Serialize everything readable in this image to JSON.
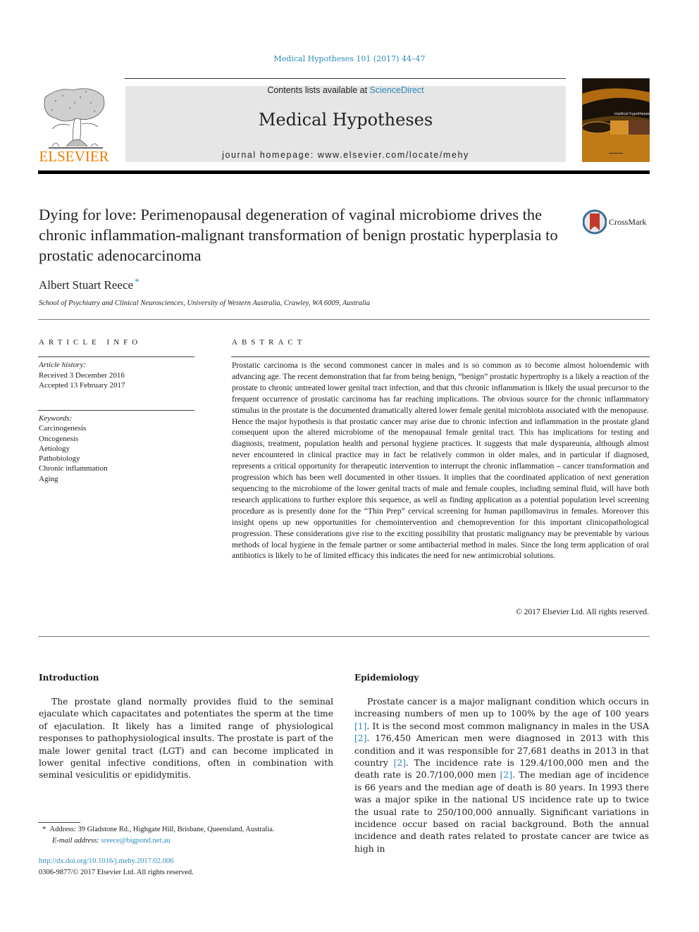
{
  "header": {
    "journal_ref": "Medical Hypotheses 101 (2017) 44–47",
    "contents_prefix": "Contents lists available at ",
    "contents_link": "ScienceDirect",
    "journal_title": "Medical Hypotheses",
    "homepage": "journal homepage: www.elsevier.com/locate/mehy",
    "publisher_wordmark": "ELSEVIER",
    "cover_title": "medical hypotheses",
    "crossmark_label": "CrossMark"
  },
  "article": {
    "title": "Dying for love: Perimenopausal degeneration of vaginal microbiome drives the chronic inflammation-malignant transformation of benign prostatic hyperplasia to prostatic adenocarcinoma",
    "author": "Albert Stuart Reece",
    "author_mark": "*",
    "affiliation": "School of Psychiatry and Clinical Neurosciences, University of Western Australia, Crawley, WA 6009, Australia"
  },
  "article_info": {
    "heading": "ARTICLE INFO",
    "history_label": "Article history:",
    "received": "Received 3 December 2016",
    "accepted": "Accepted 13 February 2017",
    "keywords_label": "Keywords:",
    "keywords": [
      "Carcinogenesis",
      "Oncogenesis",
      "Aetiology",
      "Pathobiology",
      "Chronic inflammation",
      "Aging"
    ]
  },
  "abstract": {
    "heading": "ABSTRACT",
    "text": "Prostatic carcinoma is the second commonest cancer in males and is so common as to become almost holoendemic with advancing age. The recent demonstration that far from being benign, “benign” prostatic hypertrophy is a likely a reaction of the prostate to chronic untreated lower genital tract infection, and that this chronic inflammation is likely the usual precursor to the frequent occurrence of prostatic carcinoma has far reaching implications. The obvious source for the chronic inflammatory stimulus in the prostate is the documented dramatically altered lower female genital microbiota associated with the menopause. Hence the major hypothesis is that prostatic cancer may arise due to chronic infection and inflammation in the prostate gland consequent upon the altered microbiome of the menopausal female genital tract. This has implications for testing and diagnosis, treatment, population health and personal hygiene practices. It suggests that male dyspareunia, although almost never encountered in clinical practice may in fact be relatively common in older males, and in particular if diagnosed, represents a critical opportunity for therapeutic intervention to interrupt the chronic inflammation – cancer transformation and progression which has been well documented in other tissues. It implies that the coordinated application of next generation sequencing to the microbiome of the lower genital tracts of male and female couples, including seminal fluid, will have both research applications to further explore this sequence, as well as finding application as a potential population level screening procedure as is presently done for the “Thin Prep” cervical screening for human papillomavirus in females. Moreover this insight opens up new opportunities for chemointervention and chemoprevention for this important clinicopathological progression. These considerations give rise to the exciting possibility that prostatic malignancy may be preventable by various methods of local hygiene in the female partner or some antibacterial method in males. Since the long term application of oral antibiotics is likely to be of limited efficacy this indicates the need for new antimicrobial solutions.",
    "copyright": "© 2017 Elsevier Ltd. All rights reserved."
  },
  "introduction": {
    "heading": "Introduction",
    "text": "The prostate gland normally provides fluid to the seminal ejaculate which capacitates and potentiates the sperm at the time of ejaculation. It likely has a limited range of physiological responses to pathophysiological insults. The prostate is part of the male lower genital tract (LGT) and can become implicated in lower genital infective conditions, often in combination with seminal vesiculitis or epididymitis."
  },
  "epidemiology": {
    "heading": "Epidemiology",
    "seg1": "Prostate cancer is a major malignant condition which occurs in increasing numbers of men up to 100% by the age of 100 years ",
    "ref1": "[1]",
    "seg2": ". It is the second most common malignancy in males in the USA ",
    "ref2": "[2]",
    "seg3": ". 176,450 American men were diagnosed in 2013 with this condition and it was responsible for 27,681 deaths in 2013 in that country ",
    "ref3": "[2]",
    "seg4": ". The incidence rate is 129.4/100,000 men and the death rate is 20.7/100,000 men ",
    "ref4": "[2]",
    "seg5": ". The median age of incidence is 66 years and the median age of death is 80 years. In 1993 there was a major spike in the national US incidence rate up to twice the usual rate to 250/100,000 annually. Significant variations in incidence occur based on racial background. Both the annual incidence and death rates related to prostate cancer are twice as high in"
  },
  "footnote": {
    "mark": "*",
    "address": "Address: 39 Gladstone Rd., Highgate Hill, Brisbane, Queensland, Australia.",
    "email_label": "E-mail address: ",
    "email": "sreece@bigpond.net.au"
  },
  "doi": {
    "url": "http://dx.doi.org/10.1016/j.mehy.2017.02.006",
    "issn_line": "0306-9877/© 2017 Elsevier Ltd. All rights reserved."
  }
}
